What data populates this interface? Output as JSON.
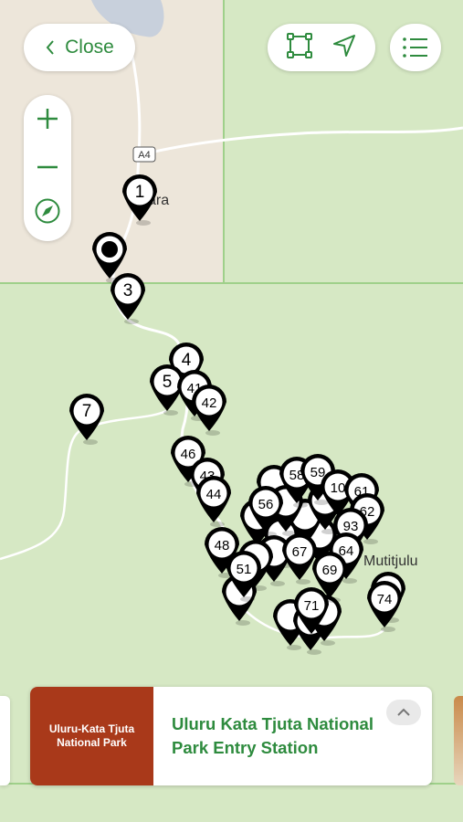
{
  "header": {
    "close_label": "Close",
    "close_icon": "chevron-left-icon",
    "tool_icons": [
      "bounding-box-icon",
      "navigation-arrow-icon"
    ],
    "list_icon": "list-icon"
  },
  "zoom": {
    "zoom_in": "+",
    "zoom_out": "−",
    "compass_icon": "compass-icon"
  },
  "map": {
    "road_shield": "A4",
    "places": [
      "ara",
      "Mutitjulu"
    ],
    "colors": {
      "park": "#d6e8c4",
      "town": "#ede6da",
      "accent": "#2e8b3e",
      "marker": "#000000"
    }
  },
  "markers": [
    {
      "label": "1"
    },
    {
      "label": ""
    },
    {
      "label": "3"
    },
    {
      "label": "4"
    },
    {
      "label": "5"
    },
    {
      "label": "41"
    },
    {
      "label": "42"
    },
    {
      "label": "7"
    },
    {
      "label": "46"
    },
    {
      "label": "43"
    },
    {
      "label": "44"
    },
    {
      "label": "56"
    },
    {
      "label": "58"
    },
    {
      "label": "59"
    },
    {
      "label": "10"
    },
    {
      "label": "61"
    },
    {
      "label": "62"
    },
    {
      "label": "93"
    },
    {
      "label": "64"
    },
    {
      "label": "48"
    },
    {
      "label": "51"
    },
    {
      "label": "67"
    },
    {
      "label": "69"
    },
    {
      "label": "71"
    },
    {
      "label": "74"
    },
    {
      "label": ""
    },
    {
      "label": ""
    },
    {
      "label": ""
    },
    {
      "label": ""
    },
    {
      "label": ""
    },
    {
      "label": ""
    },
    {
      "label": ""
    },
    {
      "label": ""
    },
    {
      "label": ""
    },
    {
      "label": ""
    },
    {
      "label": ""
    },
    {
      "label": ""
    },
    {
      "label": ""
    },
    {
      "label": ""
    }
  ],
  "card": {
    "image_text_line1": "Uluru-Kata Tjuta",
    "image_text_line2": "National Park",
    "title": "Uluru Kata Tjuta National Park Entry Station",
    "expand_icon": "chevron-up-icon"
  }
}
